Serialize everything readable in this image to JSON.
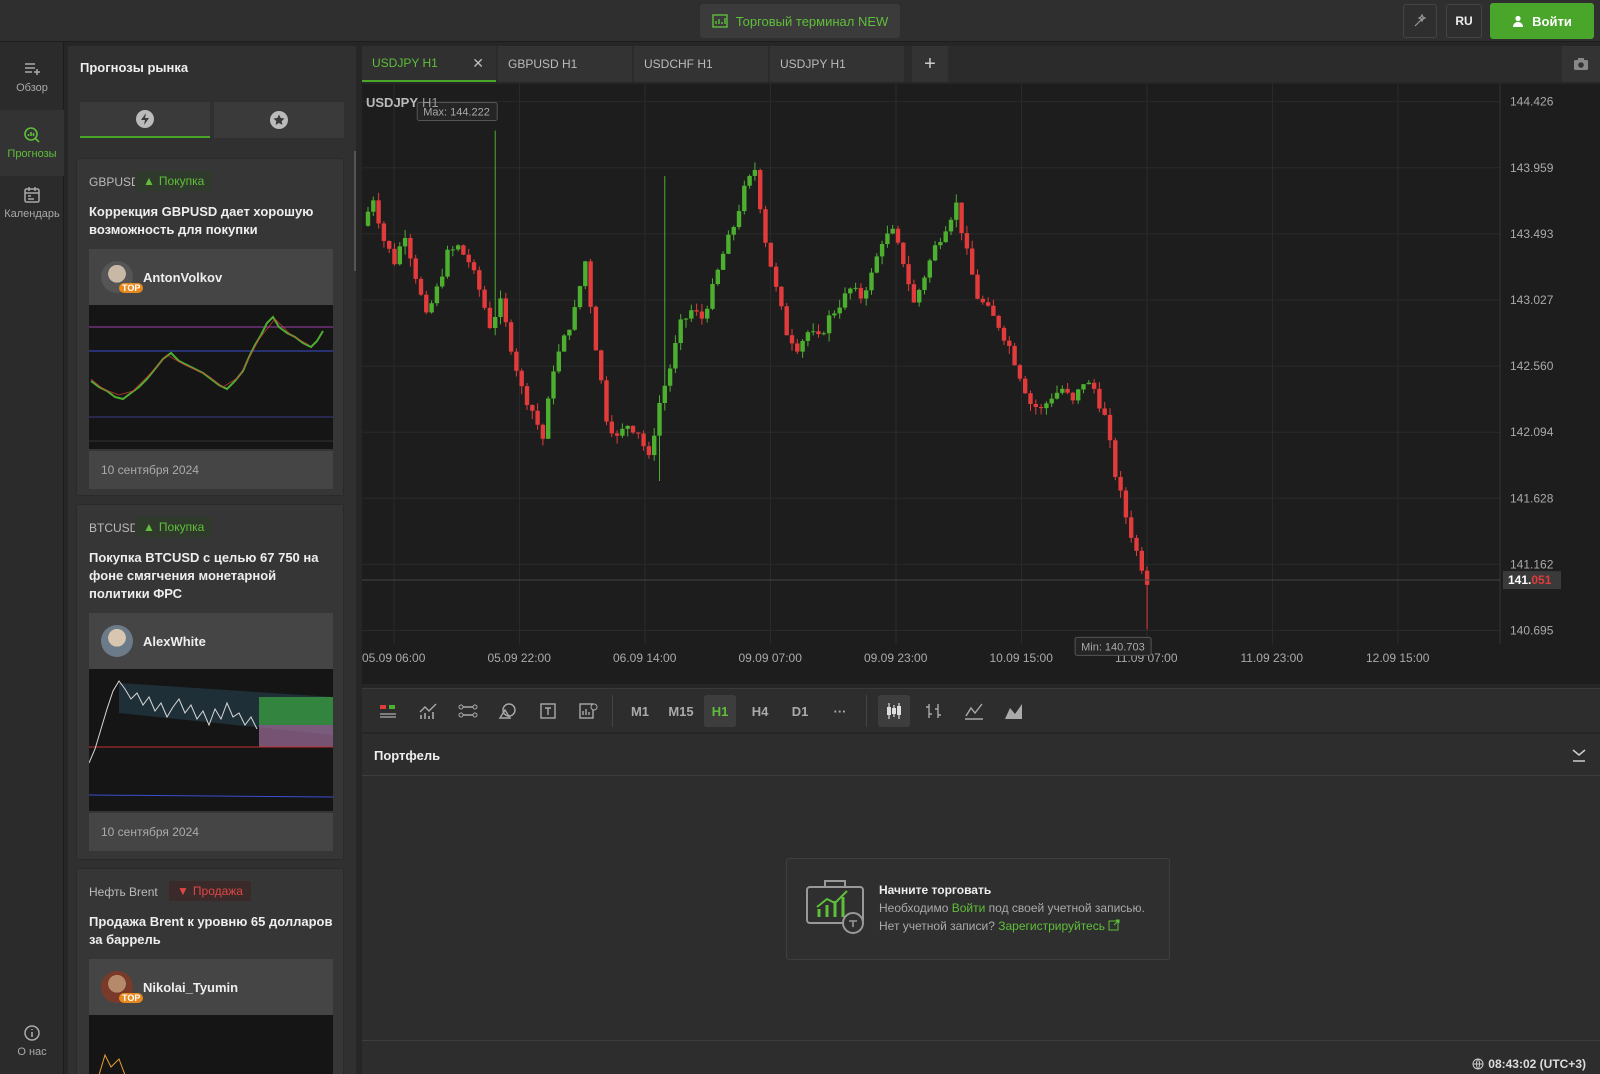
{
  "topbar": {
    "terminal_label": "Торговый терминал NEW",
    "lang": "RU",
    "login_label": "Войти"
  },
  "nav": [
    {
      "label": "Обзор",
      "icon": "overview-icon"
    },
    {
      "label": "Прогнозы",
      "icon": "forecast-icon",
      "active": true
    },
    {
      "label": "Календарь",
      "icon": "calendar-icon"
    },
    {
      "label": "О нас",
      "icon": "info-icon"
    }
  ],
  "forecasts": {
    "title": "Прогнозы рынка",
    "tabs": [
      {
        "icon": "lightning-icon",
        "active": true
      },
      {
        "icon": "star-icon"
      }
    ],
    "cards": [
      {
        "symbol": "GBPUSD",
        "signal": "Покупка",
        "direction": "buy",
        "title": "Коррекция GBPUSD дает хорошую возможность для покупки",
        "author": "AntonVolkov",
        "top": "TOP",
        "date": "10 сентября 2024"
      },
      {
        "symbol": "BTCUSD",
        "signal": "Покупка",
        "direction": "buy",
        "title": "Покупка BTCUSD с целью 67 750 на фоне смягчения монетарной политики ФРС",
        "author": "AlexWhite",
        "top": "",
        "date": "10 сентября 2024"
      },
      {
        "symbol": "Нефть Brent",
        "signal": "Продажа",
        "direction": "sell",
        "title": "Продажа Brent к уровню 65 долларов за баррель",
        "author": "Nikolai_Tyumin",
        "top": "TOP",
        "date": ""
      }
    ]
  },
  "tabs": [
    {
      "label": "USDJPY H1",
      "active": true
    },
    {
      "label": "GBPUSD H1"
    },
    {
      "label": "USDCHF H1"
    },
    {
      "label": "USDJPY H1"
    }
  ],
  "chart_data": {
    "type": "candlestick",
    "symbol": "USDJPY",
    "timeframe": "H1",
    "max_label": "Max: 144.222",
    "min_label": "Min: 140.703",
    "current_price_main": "141.",
    "current_price_tail": "051",
    "y_ticks": [
      "144.426",
      "143.959",
      "143.493",
      "143.027",
      "142.560",
      "142.094",
      "141.628",
      "141.162",
      "140.695"
    ],
    "x_ticks": [
      "05.09 06:00",
      "05.09 22:00",
      "06.09 14:00",
      "09.09 07:00",
      "09.09 23:00",
      "10.09 15:00",
      "11.09 07:00",
      "11.09 23:00",
      "12.09 15:00"
    ],
    "ylim": [
      140.6,
      144.55
    ],
    "up_color": "#4caf30",
    "down_color": "#e13b3b"
  },
  "toolbar": {
    "timeframes": [
      "M1",
      "M15",
      "H1",
      "H4",
      "D1"
    ],
    "active_tf": "H1",
    "more": "···"
  },
  "portfolio": {
    "title": "Портфель",
    "start_title": "Начните торговать",
    "line2_pre": "Необходимо ",
    "line2_link": "Войти",
    "line2_post": " под своей учетной записью.",
    "line3_pre": "Нет учетной записи? ",
    "line3_link": "Зарегистрируйтесь",
    "clock": "08:43:02 (UTC+3)"
  }
}
